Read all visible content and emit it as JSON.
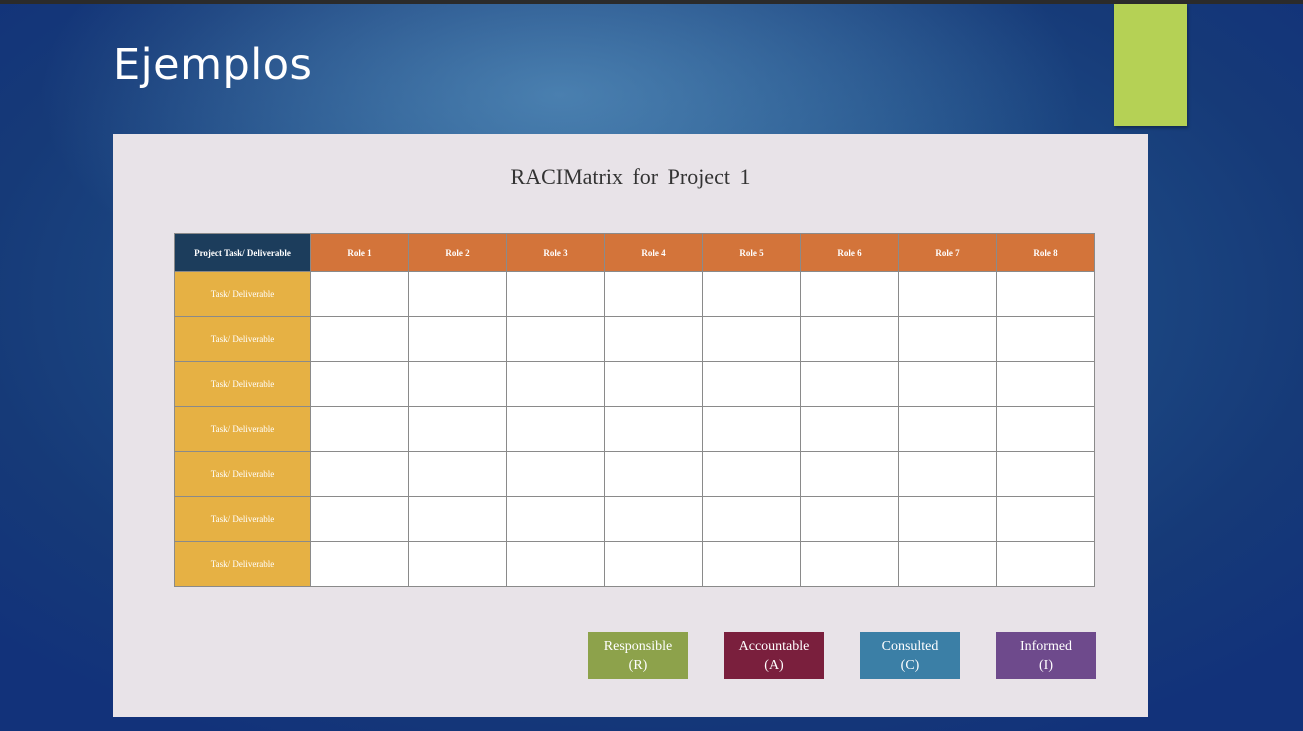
{
  "slide": {
    "title": "Ejemplos"
  },
  "matrix": {
    "title": "RACIMatrix  for  Project  1",
    "corner_header": "Project  Task/  Deliverable",
    "roles": [
      "Role 1",
      "Role 2",
      "Role 3",
      "Role 4",
      "Role 5",
      "Role 6",
      "Role 7",
      "Role 8"
    ],
    "tasks": [
      "Task/  Deliverable",
      "Task/  Deliverable",
      "Task/  Deliverable",
      "Task/  Deliverable",
      "Task/  Deliverable",
      "Task/  Deliverable",
      "Task/  Deliverable"
    ]
  },
  "legend": [
    {
      "label": "Responsible",
      "code": "(R)",
      "color": "#8da24b"
    },
    {
      "label": "Accountable",
      "code": "(A)",
      "color": "#7a1f3d"
    },
    {
      "label": "Consulted",
      "code": "(C)",
      "color": "#3b7fa6"
    },
    {
      "label": "Informed",
      "code": "(I)",
      "color": "#6e4a8c"
    }
  ],
  "colors": {
    "accent": "#b5d155",
    "header_corner": "#1c3d5c",
    "header_role": "#d3743a",
    "task_cell": "#e6b144"
  }
}
